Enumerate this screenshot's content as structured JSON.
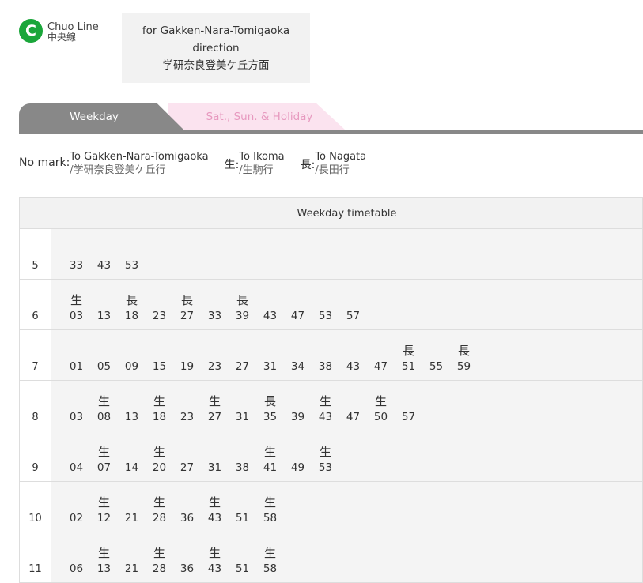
{
  "line": {
    "badge": "C",
    "name_en": "Chuo Line",
    "name_ja": "中央線",
    "color": "#1aa63a"
  },
  "direction": {
    "line1": "for Gakken-Nara-Tomigaoka",
    "line2": "direction",
    "line3": "学研奈良登美ケ丘方面"
  },
  "tabs": {
    "weekday": "Weekday",
    "holiday": "Sat., Sun. & Holiday"
  },
  "legend": [
    {
      "mark": "No mark:",
      "en": "To Gakken-Nara-Tomigaoka",
      "ja": "/学研奈良登美ケ丘行"
    },
    {
      "mark": "生:",
      "en": "To Ikoma",
      "ja": "/生駒行"
    },
    {
      "mark": "長:",
      "en": "To Nagata",
      "ja": "/長田行"
    }
  ],
  "table_title": "Weekday timetable",
  "rows": [
    {
      "hour": "5",
      "departures": [
        {
          "m": "33",
          "k": ""
        },
        {
          "m": "43",
          "k": ""
        },
        {
          "m": "53",
          "k": ""
        }
      ]
    },
    {
      "hour": "6",
      "departures": [
        {
          "m": "03",
          "k": "生"
        },
        {
          "m": "13",
          "k": ""
        },
        {
          "m": "18",
          "k": "長"
        },
        {
          "m": "23",
          "k": ""
        },
        {
          "m": "27",
          "k": "長"
        },
        {
          "m": "33",
          "k": ""
        },
        {
          "m": "39",
          "k": "長"
        },
        {
          "m": "43",
          "k": ""
        },
        {
          "m": "47",
          "k": ""
        },
        {
          "m": "53",
          "k": ""
        },
        {
          "m": "57",
          "k": ""
        }
      ]
    },
    {
      "hour": "7",
      "departures": [
        {
          "m": "01",
          "k": ""
        },
        {
          "m": "05",
          "k": ""
        },
        {
          "m": "09",
          "k": ""
        },
        {
          "m": "15",
          "k": ""
        },
        {
          "m": "19",
          "k": ""
        },
        {
          "m": "23",
          "k": ""
        },
        {
          "m": "27",
          "k": ""
        },
        {
          "m": "31",
          "k": ""
        },
        {
          "m": "34",
          "k": ""
        },
        {
          "m": "38",
          "k": ""
        },
        {
          "m": "43",
          "k": ""
        },
        {
          "m": "47",
          "k": ""
        },
        {
          "m": "51",
          "k": "長"
        },
        {
          "m": "55",
          "k": ""
        },
        {
          "m": "59",
          "k": "長"
        }
      ]
    },
    {
      "hour": "8",
      "departures": [
        {
          "m": "03",
          "k": ""
        },
        {
          "m": "08",
          "k": "生"
        },
        {
          "m": "13",
          "k": ""
        },
        {
          "m": "18",
          "k": "生"
        },
        {
          "m": "23",
          "k": ""
        },
        {
          "m": "27",
          "k": "生"
        },
        {
          "m": "31",
          "k": ""
        },
        {
          "m": "35",
          "k": "長"
        },
        {
          "m": "39",
          "k": ""
        },
        {
          "m": "43",
          "k": "生"
        },
        {
          "m": "47",
          "k": ""
        },
        {
          "m": "50",
          "k": "生"
        },
        {
          "m": "57",
          "k": ""
        }
      ]
    },
    {
      "hour": "9",
      "departures": [
        {
          "m": "04",
          "k": ""
        },
        {
          "m": "07",
          "k": "生"
        },
        {
          "m": "14",
          "k": ""
        },
        {
          "m": "20",
          "k": "生"
        },
        {
          "m": "27",
          "k": ""
        },
        {
          "m": "31",
          "k": ""
        },
        {
          "m": "38",
          "k": ""
        },
        {
          "m": "41",
          "k": "生"
        },
        {
          "m": "49",
          "k": ""
        },
        {
          "m": "53",
          "k": "生"
        }
      ]
    },
    {
      "hour": "10",
      "departures": [
        {
          "m": "02",
          "k": ""
        },
        {
          "m": "12",
          "k": "生"
        },
        {
          "m": "21",
          "k": ""
        },
        {
          "m": "28",
          "k": "生"
        },
        {
          "m": "36",
          "k": ""
        },
        {
          "m": "43",
          "k": "生"
        },
        {
          "m": "51",
          "k": ""
        },
        {
          "m": "58",
          "k": "生"
        }
      ]
    },
    {
      "hour": "11",
      "departures": [
        {
          "m": "06",
          "k": ""
        },
        {
          "m": "13",
          "k": "生"
        },
        {
          "m": "21",
          "k": ""
        },
        {
          "m": "28",
          "k": "生"
        },
        {
          "m": "36",
          "k": ""
        },
        {
          "m": "43",
          "k": "生"
        },
        {
          "m": "51",
          "k": ""
        },
        {
          "m": "58",
          "k": "生"
        }
      ]
    }
  ]
}
